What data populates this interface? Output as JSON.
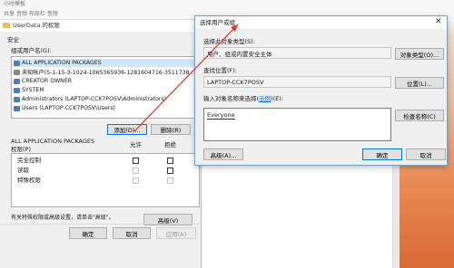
{
  "explorer": {
    "title_fragment": "小时模板",
    "menu_fragment": "共享    音频    布局栏     音频"
  },
  "properties": {
    "title": "UserData 的权限",
    "tab_security": "安全",
    "group_label": "组或用户名(G):",
    "principals": [
      "ALL APPLICATION PACKAGES",
      "未知帐户(S-1-15-3-1024-1065365936-1281604716-3511738...",
      "CREATOR OWNER",
      "SYSTEM",
      "Administrators (LAPTOP-CCK7POSV\\Administrators)",
      "Users (LAPTOP-CCK7POSV\\Users)"
    ],
    "add_button": "添加(D)...",
    "remove_button": "删除(R)",
    "perm_title": "ALL APPLICATION PACKAGES",
    "perm_title2": "权限(P)",
    "allow_header": "允许",
    "deny_header": "拒绝",
    "permissions": [
      "完全控制",
      "读取",
      "特殊权限"
    ],
    "advanced_note": "有关特殊权限或高级设置，请单击\"高级\"。",
    "advanced_button": "高级(V)",
    "ok_button": "确定",
    "cancel_button": "取消",
    "apply_button": "应用(A)"
  },
  "select_dialog": {
    "title": "选择用户或组",
    "object_type_label": "选择此对象类型(S):",
    "object_type_value": "用户、组或内置安全主体",
    "object_type_button": "对象类型(O)...",
    "location_label": "查找位置(F):",
    "location_value": "LAPTOP-CCK7POSV",
    "location_button": "位置(L)...",
    "names_label_prefix": "输入对象名称来选择(",
    "names_link": "示例",
    "names_label_suffix": ")(E):",
    "names_value": "Everyone",
    "check_names_button": "检查名称(C)",
    "advanced_button": "高级(A)...",
    "ok_button": "确定",
    "cancel_button": "取消"
  }
}
